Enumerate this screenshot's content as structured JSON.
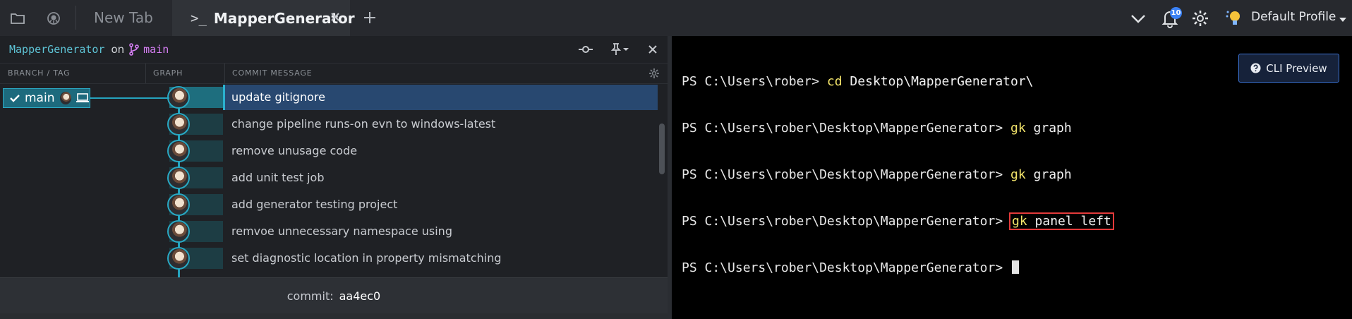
{
  "tabs": {
    "inactive_label": "New Tab",
    "active_prompt": ">_",
    "active_label": "MapperGenerator"
  },
  "topbar_right": {
    "notification_count": "10",
    "profile_label": "Default Profile"
  },
  "repo_bar": {
    "repo_name": "MapperGenerator",
    "on_text": "on",
    "branch_name": "main"
  },
  "columns": {
    "branch_tag": "BRANCH / TAG",
    "graph": "GRAPH",
    "commit_message": "COMMIT MESSAGE"
  },
  "branch_chip": {
    "label": "main"
  },
  "commits": [
    {
      "message": "update gitignore",
      "selected": true
    },
    {
      "message": "change pipeline runs-on evn to windows-latest",
      "selected": false
    },
    {
      "message": "remove unusage code",
      "selected": false
    },
    {
      "message": "add unit test job",
      "selected": false
    },
    {
      "message": "add generator testing project",
      "selected": false
    },
    {
      "message": "remvoe unnecessary namespace using",
      "selected": false
    },
    {
      "message": "set diagnostic location in property mismatching",
      "selected": false
    }
  ],
  "commit_bar": {
    "label": "commit:",
    "sha": "aa4ec0"
  },
  "terminal": {
    "lines": [
      {
        "prompt": "PS C:\\Users\\rober> ",
        "cmd": "cd",
        "args": " Desktop\\MapperGenerator\\"
      },
      {
        "prompt": "PS C:\\Users\\rober\\Desktop\\MapperGenerator> ",
        "cmd": "gk",
        "args": " graph"
      },
      {
        "prompt": "PS C:\\Users\\rober\\Desktop\\MapperGenerator> ",
        "cmd": "gk",
        "args": " graph"
      },
      {
        "prompt": "PS C:\\Users\\rober\\Desktop\\MapperGenerator> ",
        "cmd": "gk",
        "args": " panel left"
      },
      {
        "prompt": "PS C:\\Users\\rober\\Desktop\\MapperGenerator> ",
        "cmd": "",
        "args": ""
      }
    ],
    "highlighted_line": 3
  },
  "cli_preview": {
    "label": "CLI Preview"
  },
  "colors": {
    "accent_teal": "#25a3be",
    "branch_purple": "#d77ff5",
    "terminal_command": "#f2e36a",
    "highlight_red": "#e33a3a",
    "selection_blue": "#284870"
  },
  "icons": {
    "topbar_left": [
      "folder-icon",
      "gitkraken-icon"
    ],
    "topbar_right": [
      "chevron-down-icon",
      "bell-icon",
      "gear-icon",
      "lightbulb-icon"
    ],
    "repo_bar_right": [
      "commit-graph-icon",
      "pin-icon",
      "close-icon"
    ]
  }
}
